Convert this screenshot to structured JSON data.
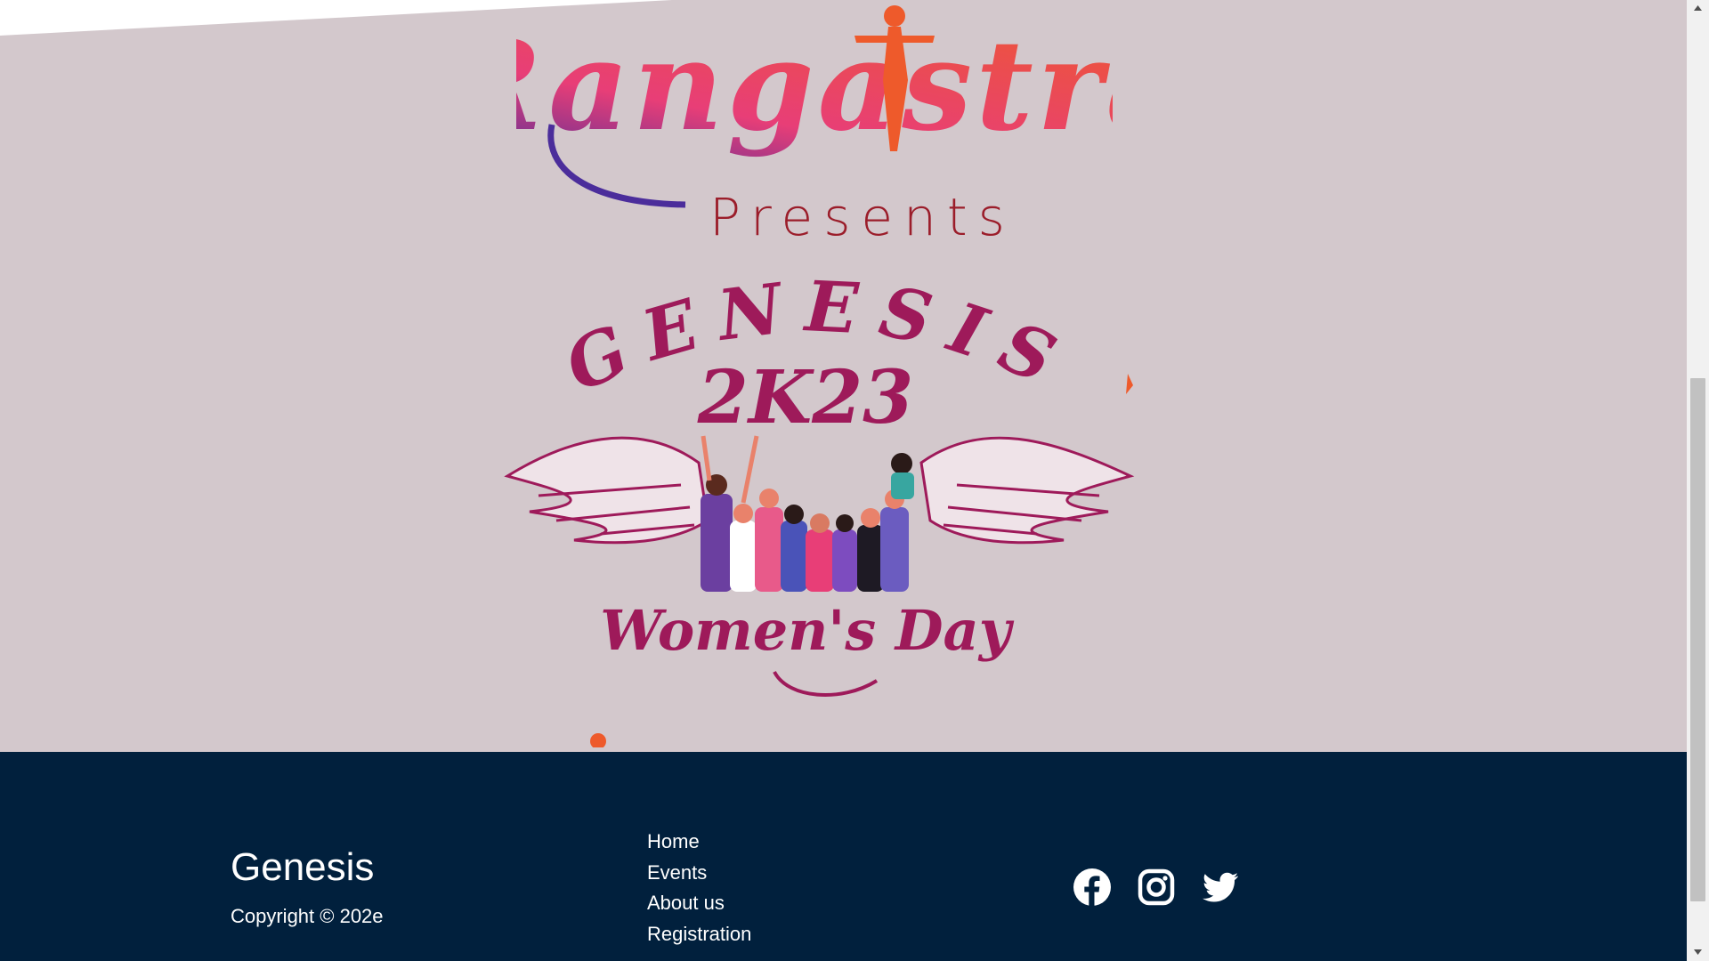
{
  "hero": {
    "logo_text": "Rangastra",
    "presents": "Presents",
    "genesis_title": "GENESIS",
    "genesis_year": "2K23",
    "event_tagline": "Women's Day"
  },
  "footer": {
    "brand": "Genesis",
    "copyright": "Copyright © 202e",
    "links": [
      {
        "label": "Home"
      },
      {
        "label": "Events"
      },
      {
        "label": "About us"
      },
      {
        "label": "Registration"
      }
    ],
    "socials": [
      "facebook-icon",
      "instagram-icon",
      "twitter-icon"
    ]
  },
  "colors": {
    "hero_bg": "#d3c8cc",
    "footer_bg": "#01203d",
    "presents": "#9b1d2a",
    "genesis": "#9e1a5a",
    "logo_orange": "#ee5a2b",
    "logo_pink": "#e83e77",
    "logo_purple": "#4b2d9b"
  }
}
